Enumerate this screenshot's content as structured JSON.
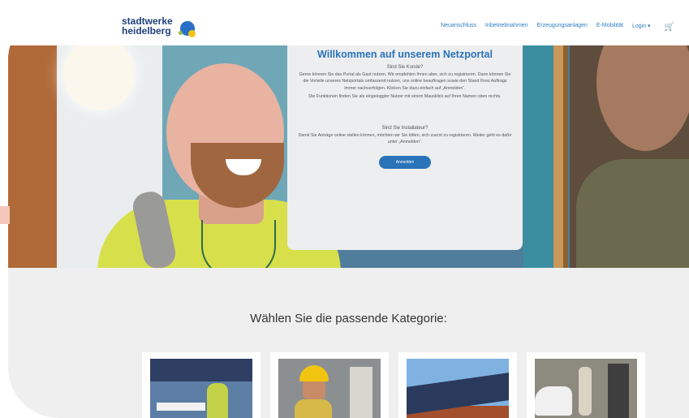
{
  "header": {
    "logo_line1": "stadtwerke",
    "logo_line2": "heidelberg",
    "nav": [
      "Neuanschluss",
      "Inbetriebnahmen",
      "Erzeugungsanlagen",
      "E-Mobilität",
      "Login ▾"
    ],
    "cart_icon": "cart-icon"
  },
  "welcome": {
    "title": "Willkommen auf unserem Netzportal",
    "customer_question": "Sind Sie Kunde?",
    "customer_text_1": "Gerne können Sie das Portal als Gast nutzen. Wir empfehlen Ihnen aber, sich zu registrieren. Dann können Sie die Vorteile unseres Netzportals umfassend nutzen, uns online beauftragen sowie den Stand Ihres Auftrags immer nachverfolgen. Klicken Sie dazu einfach auf „Anmelden“.",
    "customer_text_2": "Die Funktionen finden Sie als eingeloggter Nutzer mit einem Mausklick auf Ihren Namen oben rechts.",
    "installer_question": "Sind Sie Installateur?",
    "installer_text": "Damit Sie Anträge online stellen können, möchten wir Sie bitten, sich zuerst zu registrieren. Weiter geht es dafür unter „Anmelden“.",
    "button": "Anmelden"
  },
  "category": {
    "title": "Wählen Sie die passende Kategorie:"
  },
  "colors": {
    "brand_blue": "#2a73b9",
    "logo_navy": "#1e3f7a",
    "background": "#efefef"
  }
}
